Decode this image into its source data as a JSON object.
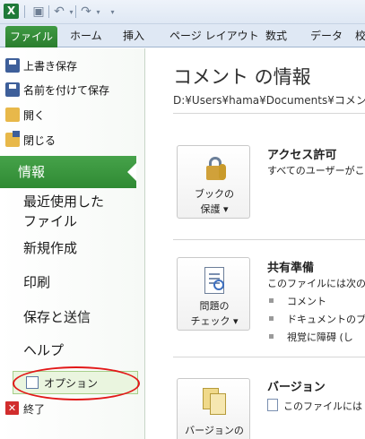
{
  "qat": {
    "app_icon": "X",
    "save_icon": "save-icon",
    "undo_icon": "undo-icon",
    "redo_icon": "redo-icon",
    "customize_icon": "customize-qat-icon"
  },
  "tabs": {
    "file": "ファイル",
    "items": [
      "ホーム",
      "挿入",
      "ページ レイアウト",
      "数式",
      "データ",
      "校"
    ]
  },
  "nav": {
    "save": "上書き保存",
    "save_as": "名前を付けて保存",
    "open": "開く",
    "close": "閉じる",
    "info": "情報",
    "recent_line1": "最近使用した",
    "recent_line2": "ファイル",
    "new": "新規作成",
    "print": "印刷",
    "save_send": "保存と送信",
    "help": "ヘルプ",
    "options": "オプション",
    "exit": "終了"
  },
  "main": {
    "title": "コメント の情報",
    "path": "D:¥Users¥hama¥Documents¥コメント",
    "protect_btn_line1": "ブックの",
    "protect_btn_line2": "保護 ▾",
    "permissions_head": "アクセス許可",
    "permissions_text": "すべてのユーザーがこの",
    "check_btn_line1": "問題の",
    "check_btn_line2": "チェック ▾",
    "prepare_head": "共有準備",
    "prepare_text": "このファイルには次の項",
    "bullets": [
      "コメント",
      "ドキュメントのプロ",
      "視覚に障碍 (し"
    ],
    "version_btn_line1": "バージョンの",
    "version_head": "バージョン",
    "version_text": "このファイルには"
  }
}
